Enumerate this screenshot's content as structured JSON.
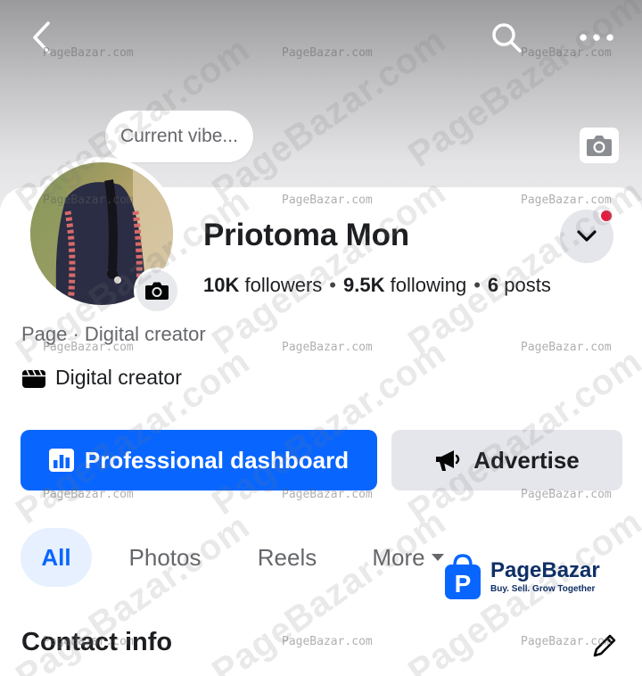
{
  "header": {
    "back_icon": "chevron-left-icon",
    "search_icon": "search-icon",
    "more_icon": "more-horizontal-icon",
    "cover_camera_icon": "camera-icon"
  },
  "status_note": {
    "text": "Current vibe..."
  },
  "profile": {
    "name": "Priotoma Mon",
    "followers_count": "10K",
    "followers_label": "followers",
    "following_count": "9.5K",
    "following_label": "following",
    "posts_count": "6",
    "posts_label": "posts",
    "separator": "•",
    "category": "Page · Digital creator",
    "creator_label": "Digital creator"
  },
  "actions": {
    "dashboard_label": "Professional dashboard",
    "advertise_label": "Advertise"
  },
  "tabs": [
    {
      "label": "All",
      "active": true
    },
    {
      "label": "Photos",
      "active": false
    },
    {
      "label": "Reels",
      "active": false
    },
    {
      "label": "More",
      "active": false
    }
  ],
  "sections": {
    "contact_info": "Contact info"
  },
  "watermark": {
    "text": "PageBazar.com",
    "logo_title": "PageBazar",
    "logo_tagline": "Buy. Sell. Grow Together",
    "logo_letter": "P"
  },
  "colors": {
    "accent": "#0866ff",
    "notification": "#e41e3f",
    "active_tab_bg": "#e7f0ff",
    "secondary_button_bg": "#e4e6eb"
  }
}
